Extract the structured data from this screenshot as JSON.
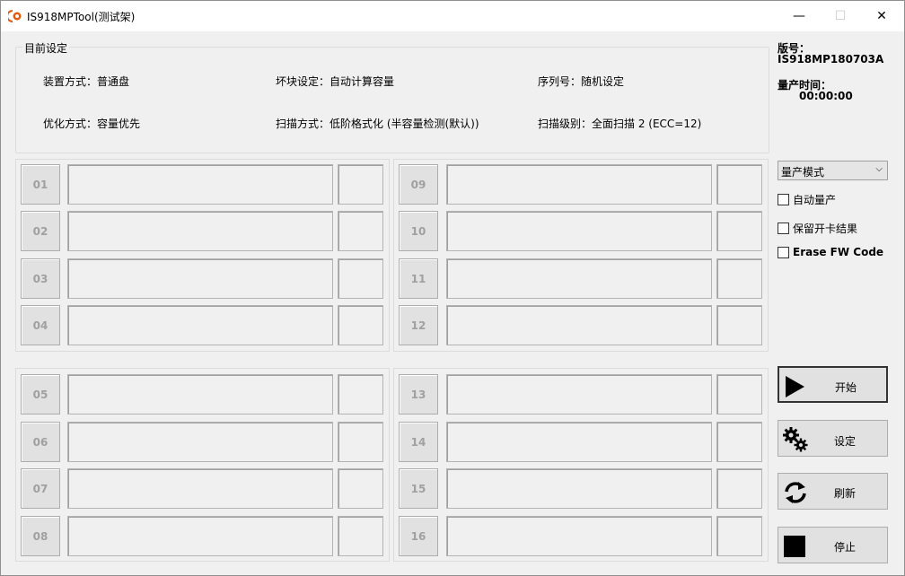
{
  "window": {
    "title": "IS918MPTool(测试架)",
    "min_glyph": "—",
    "max_glyph": "☐",
    "close_glyph": "✕"
  },
  "settings": {
    "title": "目前设定",
    "mount": "装置方式：普通盘",
    "badblock": "坏块设定：自动计算容量",
    "serial": "序列号：随机设定",
    "optimize": "优化方式：容量优先",
    "scan_method": "扫描方式：低阶格式化 (半容量检测(默认))",
    "scan_level": "扫描级别：全面扫描 2 (ECC=12)"
  },
  "slots": {
    "s01": "01",
    "s02": "02",
    "s03": "03",
    "s04": "04",
    "s05": "05",
    "s06": "06",
    "s07": "07",
    "s08": "08",
    "s09": "09",
    "s10": "10",
    "s11": "11",
    "s12": "12",
    "s13": "13",
    "s14": "14",
    "s15": "15",
    "s16": "16"
  },
  "info": {
    "version_label": "版号：",
    "version_value": "IS918MP180703A",
    "time_label": "量产时间：",
    "time_value": "00:00:00"
  },
  "mode_select": {
    "value": "量产模式",
    "arrow": "⌵"
  },
  "options": {
    "auto_mp": "自动量产",
    "keep_result": "保留开卡结果",
    "erase_fw": "Erase FW Code"
  },
  "actions": {
    "start": "开始",
    "settings": "设定",
    "refresh": "刷新",
    "stop": "停止"
  },
  "icons": {
    "app": "app-logo-icon",
    "start": "play-icon",
    "settings": "gears-icon",
    "refresh": "refresh-icon",
    "stop": "stop-icon"
  }
}
